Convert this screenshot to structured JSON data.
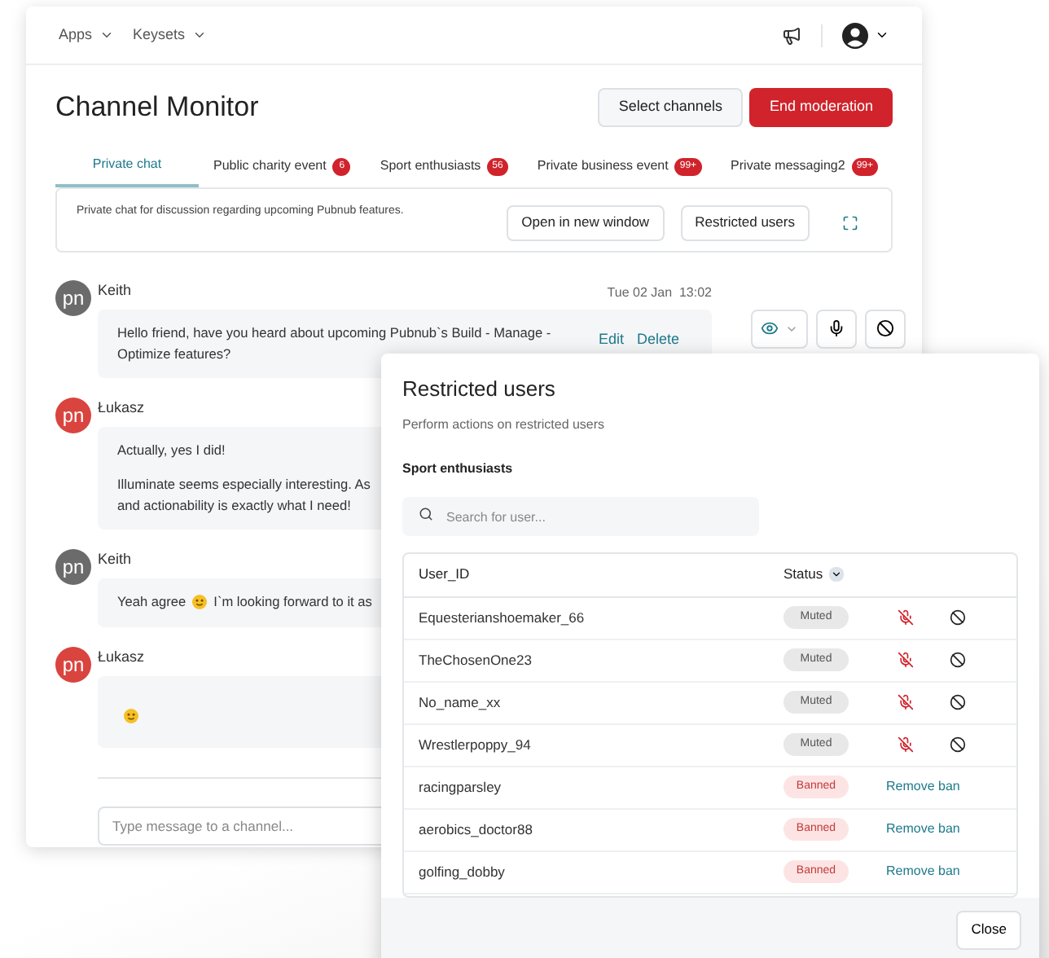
{
  "nav": {
    "menus": [
      "Apps",
      "Keysets"
    ]
  },
  "page": {
    "title": "Channel Monitor",
    "buttons": [
      {
        "label": "Select channels",
        "kind": "secondary"
      },
      {
        "label": "End moderation",
        "kind": "danger"
      }
    ]
  },
  "tabs": [
    {
      "label": "Private chat",
      "selected": true
    },
    {
      "label": "Public charity event",
      "badge": "6",
      "selected": false
    },
    {
      "label": "Sport enthusiasts",
      "badge": "56",
      "selected": false
    },
    {
      "label": "Private business event",
      "badge": "99+",
      "selected": false
    },
    {
      "label": "Private messaging2",
      "badge": "99+",
      "selected": false
    }
  ],
  "channel_info": {
    "description": "Private chat for discussion regarding upcoming Pubnub features.",
    "buttons": [
      "Open in new window",
      "Restricted users"
    ]
  },
  "messages": [
    {
      "author": "Keith",
      "avatar": "pn",
      "color": "#6b6b6b",
      "time": "Tue 02 Jan  13:02",
      "paragraphs": [
        [
          "Hello friend, have you heard about upcoming Pubnub`s Build - Manage -",
          "Optimize features?"
        ]
      ],
      "actions": [
        "Edit",
        "Delete"
      ]
    },
    {
      "author": "Łukasz",
      "avatar": "pn",
      "color": "#d9443f",
      "paragraphs": [
        [
          "Actually, yes I did!"
        ],
        [
          "Illuminate seems especially interesting. As",
          "and actionability is exactly what I need!"
        ]
      ]
    },
    {
      "author": "Keith",
      "avatar": "pn",
      "color": "#6b6b6b",
      "paragraphs": [
        [
          "Yeah agree",
          "I`m looking forward to it as"
        ]
      ],
      "emoji_after_first": true
    },
    {
      "author": "Łukasz",
      "avatar": "pn",
      "color": "#d9443f",
      "emoji_only": true
    }
  ],
  "composer": {
    "placeholder": "Type message to a channel..."
  },
  "restricted_users": {
    "title": "Restricted users",
    "subtitle": "Perform actions on restricted users",
    "channel": "Sport enthusiasts",
    "search_placeholder": "Search for user...",
    "columns": [
      "User_ID",
      "Status"
    ],
    "rows": [
      {
        "user_id": "Equesterianshoemaker_66",
        "status": "Muted",
        "kind": "muted"
      },
      {
        "user_id": "TheChosenOne23",
        "status": "Muted",
        "kind": "muted"
      },
      {
        "user_id": "No_name_xx",
        "status": "Muted",
        "kind": "muted"
      },
      {
        "user_id": "Wrestlerpoppy_94",
        "status": "Muted",
        "kind": "muted"
      },
      {
        "user_id": "racingparsley",
        "status": "Banned",
        "kind": "banned",
        "action": "Remove ban"
      },
      {
        "user_id": "aerobics_doctor88",
        "status": "Banned",
        "kind": "banned",
        "action": "Remove ban"
      },
      {
        "user_id": "golfing_dobby",
        "status": "Banned",
        "kind": "banned",
        "action": "Remove ban"
      }
    ],
    "close": "Close"
  }
}
